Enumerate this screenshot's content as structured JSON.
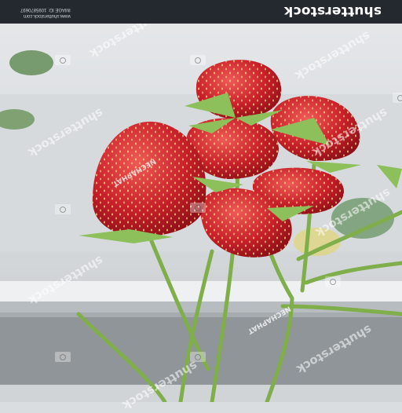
{
  "stock_bar": {
    "logo_text": "shutterstock",
    "site_url": "www.shutterstock.com",
    "image_id_text": "IMAGE ID: 1095870697"
  },
  "watermark": {
    "text": "shutterstock",
    "mark_text": "NECHAPHAT"
  },
  "colors": {
    "bar": "#24292f",
    "strawberry": "#c8202a",
    "stem": "#7fae4a",
    "background": "#d9dde0"
  }
}
